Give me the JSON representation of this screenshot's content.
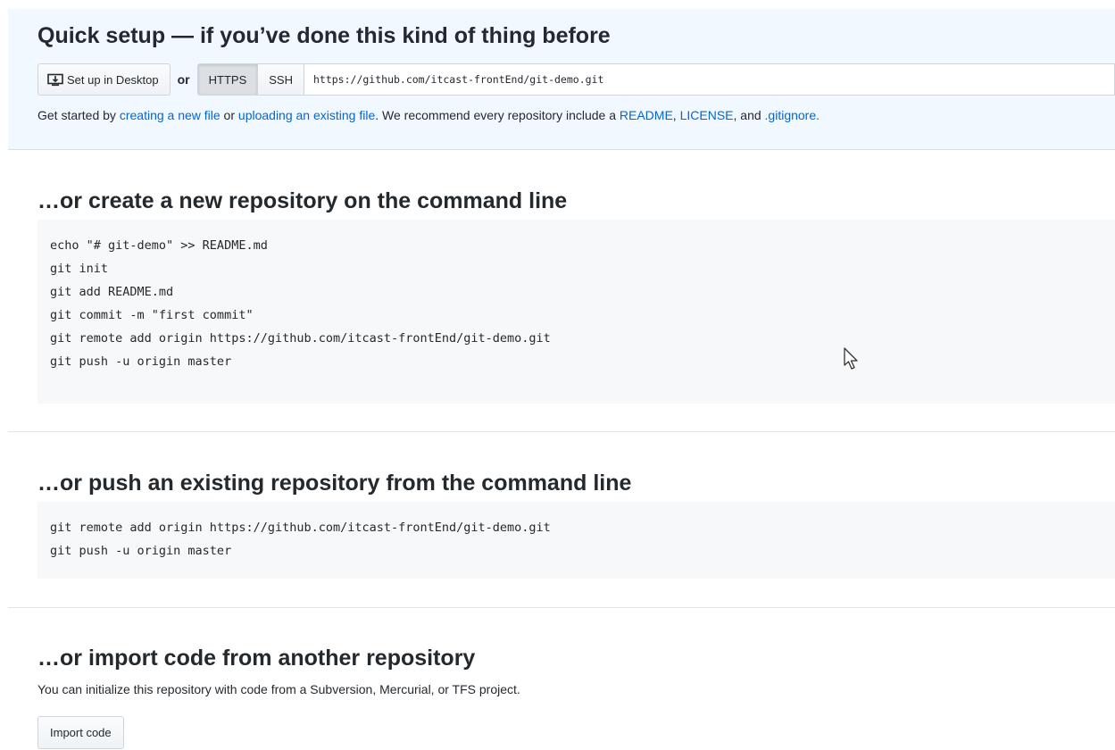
{
  "quick_setup": {
    "title": "Quick setup — if you’ve done this kind of thing before",
    "desktop_button": "Set up in Desktop",
    "or_label": "or",
    "protocols": [
      "HTTPS",
      "SSH"
    ],
    "selected_protocol": "HTTPS",
    "clone_url": "https://github.com/itcast-frontEnd/git-demo.git",
    "desc": {
      "prefix": "Get started by ",
      "link_new_file": "creating a new file",
      "or": " or ",
      "link_upload": "uploading an existing file",
      "middle": ". We recommend every repository include a ",
      "link_readme": "README",
      "comma1": ", ",
      "link_license": "LICENSE",
      "and": ", and ",
      "link_gitignore": ".gitignore."
    }
  },
  "create_section": {
    "title": "…or create a new repository on the command line",
    "code_lines": [
      "echo \"# git-demo\" >> README.md",
      "git init",
      "git add README.md",
      "git commit -m \"first commit\"",
      "git remote add origin https://github.com/itcast-frontEnd/git-demo.git",
      "git push -u origin master"
    ]
  },
  "push_section": {
    "title": "…or push an existing repository from the command line",
    "code_lines": [
      "git remote add origin https://github.com/itcast-frontEnd/git-demo.git",
      "git push -u origin master"
    ]
  },
  "import_section": {
    "title": "…or import code from another repository",
    "desc": "You can initialize this repository with code from a Subversion, Mercurial, or TFS project.",
    "button": "Import code"
  },
  "icons": {
    "desktop": "desktop-download-icon",
    "cursor": "mouse-pointer-icon"
  },
  "colors": {
    "link": "#0366d6",
    "quick_setup_bg": "#f1f8ff",
    "code_bg": "#f6f8fa"
  }
}
